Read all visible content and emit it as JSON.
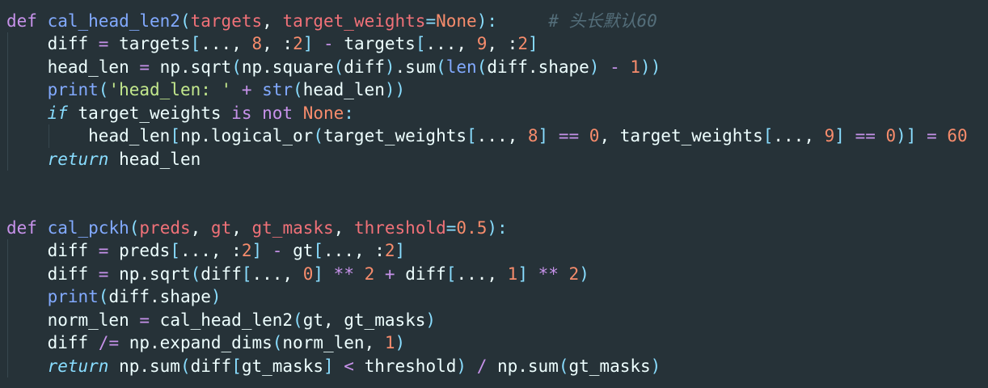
{
  "editor": {
    "language": "python",
    "lines": [
      {
        "indent": 0,
        "tokens": [
          [
            "def",
            "kw"
          ],
          [
            " ",
            "txt"
          ],
          [
            "cal_head_len2",
            "fn"
          ],
          [
            "(",
            "punc"
          ],
          [
            "targets",
            "param"
          ],
          [
            ", ",
            "txt"
          ],
          [
            "target_weights",
            "param"
          ],
          [
            "=",
            "punc"
          ],
          [
            "None",
            "num"
          ],
          [
            ")",
            "punc"
          ],
          [
            ":",
            "punc"
          ],
          [
            "     ",
            "txt"
          ],
          [
            "# 头长默认60",
            "cmt"
          ]
        ]
      },
      {
        "indent": 1,
        "tokens": [
          [
            "diff ",
            "txt"
          ],
          [
            "=",
            "op"
          ],
          [
            " targets",
            "txt"
          ],
          [
            "[",
            "punc"
          ],
          [
            "..., ",
            "txt"
          ],
          [
            "8",
            "num"
          ],
          [
            ", :",
            "txt"
          ],
          [
            "2",
            "num"
          ],
          [
            "]",
            "punc"
          ],
          [
            " - ",
            "op"
          ],
          [
            "targets",
            "txt"
          ],
          [
            "[",
            "punc"
          ],
          [
            "..., ",
            "txt"
          ],
          [
            "9",
            "num"
          ],
          [
            ", :",
            "txt"
          ],
          [
            "2",
            "num"
          ],
          [
            "]",
            "punc"
          ]
        ]
      },
      {
        "indent": 1,
        "tokens": [
          [
            "head_len ",
            "txt"
          ],
          [
            "=",
            "op"
          ],
          [
            " np.sqrt",
            "txt"
          ],
          [
            "(",
            "punc"
          ],
          [
            "np.square",
            "txt"
          ],
          [
            "(",
            "punc"
          ],
          [
            "diff",
            "txt"
          ],
          [
            ")",
            "punc"
          ],
          [
            ".sum",
            "txt"
          ],
          [
            "(",
            "punc"
          ],
          [
            "len",
            "builtin"
          ],
          [
            "(",
            "punc"
          ],
          [
            "diff.shape",
            "txt"
          ],
          [
            ")",
            "punc"
          ],
          [
            " - ",
            "op"
          ],
          [
            "1",
            "num"
          ],
          [
            "))",
            "punc"
          ]
        ]
      },
      {
        "indent": 1,
        "tokens": [
          [
            "print",
            "builtin"
          ],
          [
            "(",
            "punc"
          ],
          [
            "'head_len: '",
            "str"
          ],
          [
            " + ",
            "op"
          ],
          [
            "str",
            "builtin"
          ],
          [
            "(",
            "punc"
          ],
          [
            "head_len",
            "txt"
          ],
          [
            "))",
            "punc"
          ]
        ]
      },
      {
        "indent": 1,
        "tokens": [
          [
            "if",
            "ctrl"
          ],
          [
            " target_weights ",
            "txt"
          ],
          [
            "is",
            "kw"
          ],
          [
            " ",
            "txt"
          ],
          [
            "not",
            "kw"
          ],
          [
            " ",
            "txt"
          ],
          [
            "None",
            "num"
          ],
          [
            ":",
            "punc"
          ]
        ]
      },
      {
        "indent": 2,
        "tokens": [
          [
            "head_len",
            "txt"
          ],
          [
            "[",
            "punc"
          ],
          [
            "np.logical_or",
            "txt"
          ],
          [
            "(",
            "punc"
          ],
          [
            "target_weights",
            "txt"
          ],
          [
            "[",
            "punc"
          ],
          [
            "..., ",
            "txt"
          ],
          [
            "8",
            "num"
          ],
          [
            "]",
            "punc"
          ],
          [
            " == ",
            "op"
          ],
          [
            "0",
            "num"
          ],
          [
            ", target_weights",
            "txt"
          ],
          [
            "[",
            "punc"
          ],
          [
            "..., ",
            "txt"
          ],
          [
            "9",
            "num"
          ],
          [
            "]",
            "punc"
          ],
          [
            " == ",
            "op"
          ],
          [
            "0",
            "num"
          ],
          [
            ")]",
            "punc"
          ],
          [
            " = ",
            "op"
          ],
          [
            "60",
            "num"
          ]
        ]
      },
      {
        "indent": 1,
        "tokens": [
          [
            "return",
            "ctrl"
          ],
          [
            " head_len",
            "txt"
          ]
        ]
      },
      {
        "indent": 0,
        "tokens": []
      },
      {
        "indent": 0,
        "tokens": []
      },
      {
        "indent": 0,
        "tokens": [
          [
            "def",
            "kw"
          ],
          [
            " ",
            "txt"
          ],
          [
            "cal_pckh",
            "fn"
          ],
          [
            "(",
            "punc"
          ],
          [
            "preds",
            "param"
          ],
          [
            ", ",
            "txt"
          ],
          [
            "gt",
            "param"
          ],
          [
            ", ",
            "txt"
          ],
          [
            "gt_masks",
            "param"
          ],
          [
            ", ",
            "txt"
          ],
          [
            "threshold",
            "param"
          ],
          [
            "=",
            "punc"
          ],
          [
            "0.5",
            "num"
          ],
          [
            ")",
            "punc"
          ],
          [
            ":",
            "punc"
          ]
        ]
      },
      {
        "indent": 1,
        "tokens": [
          [
            "diff ",
            "txt"
          ],
          [
            "=",
            "op"
          ],
          [
            " preds",
            "txt"
          ],
          [
            "[",
            "punc"
          ],
          [
            "..., :",
            "txt"
          ],
          [
            "2",
            "num"
          ],
          [
            "]",
            "punc"
          ],
          [
            " - ",
            "op"
          ],
          [
            "gt",
            "txt"
          ],
          [
            "[",
            "punc"
          ],
          [
            "..., :",
            "txt"
          ],
          [
            "2",
            "num"
          ],
          [
            "]",
            "punc"
          ]
        ]
      },
      {
        "indent": 1,
        "tokens": [
          [
            "diff ",
            "txt"
          ],
          [
            "=",
            "op"
          ],
          [
            " np.sqrt",
            "txt"
          ],
          [
            "(",
            "punc"
          ],
          [
            "diff",
            "txt"
          ],
          [
            "[",
            "punc"
          ],
          [
            "..., ",
            "txt"
          ],
          [
            "0",
            "num"
          ],
          [
            "]",
            "punc"
          ],
          [
            " ** ",
            "op"
          ],
          [
            "2",
            "num"
          ],
          [
            " + ",
            "op"
          ],
          [
            "diff",
            "txt"
          ],
          [
            "[",
            "punc"
          ],
          [
            "..., ",
            "txt"
          ],
          [
            "1",
            "num"
          ],
          [
            "]",
            "punc"
          ],
          [
            " ** ",
            "op"
          ],
          [
            "2",
            "num"
          ],
          [
            ")",
            "punc"
          ]
        ]
      },
      {
        "indent": 1,
        "tokens": [
          [
            "print",
            "builtin"
          ],
          [
            "(",
            "punc"
          ],
          [
            "diff.shape",
            "txt"
          ],
          [
            ")",
            "punc"
          ]
        ]
      },
      {
        "indent": 1,
        "tokens": [
          [
            "norm_len ",
            "txt"
          ],
          [
            "=",
            "op"
          ],
          [
            " cal_head_len2",
            "txt"
          ],
          [
            "(",
            "punc"
          ],
          [
            "gt, gt_masks",
            "txt"
          ],
          [
            ")",
            "punc"
          ]
        ]
      },
      {
        "indent": 1,
        "tokens": [
          [
            "diff ",
            "txt"
          ],
          [
            "/=",
            "op"
          ],
          [
            " np.expand_dims",
            "txt"
          ],
          [
            "(",
            "punc"
          ],
          [
            "norm_len, ",
            "txt"
          ],
          [
            "1",
            "num"
          ],
          [
            ")",
            "punc"
          ]
        ]
      },
      {
        "indent": 1,
        "tokens": [
          [
            "return",
            "ctrl"
          ],
          [
            " np.sum",
            "txt"
          ],
          [
            "(",
            "punc"
          ],
          [
            "diff",
            "txt"
          ],
          [
            "[",
            "punc"
          ],
          [
            "gt_masks",
            "txt"
          ],
          [
            "]",
            "punc"
          ],
          [
            " < ",
            "op"
          ],
          [
            "threshold",
            "txt"
          ],
          [
            ")",
            "punc"
          ],
          [
            " / ",
            "op"
          ],
          [
            "np.sum",
            "txt"
          ],
          [
            "(",
            "punc"
          ],
          [
            "gt_masks",
            "txt"
          ],
          [
            ")",
            "punc"
          ]
        ]
      }
    ]
  }
}
